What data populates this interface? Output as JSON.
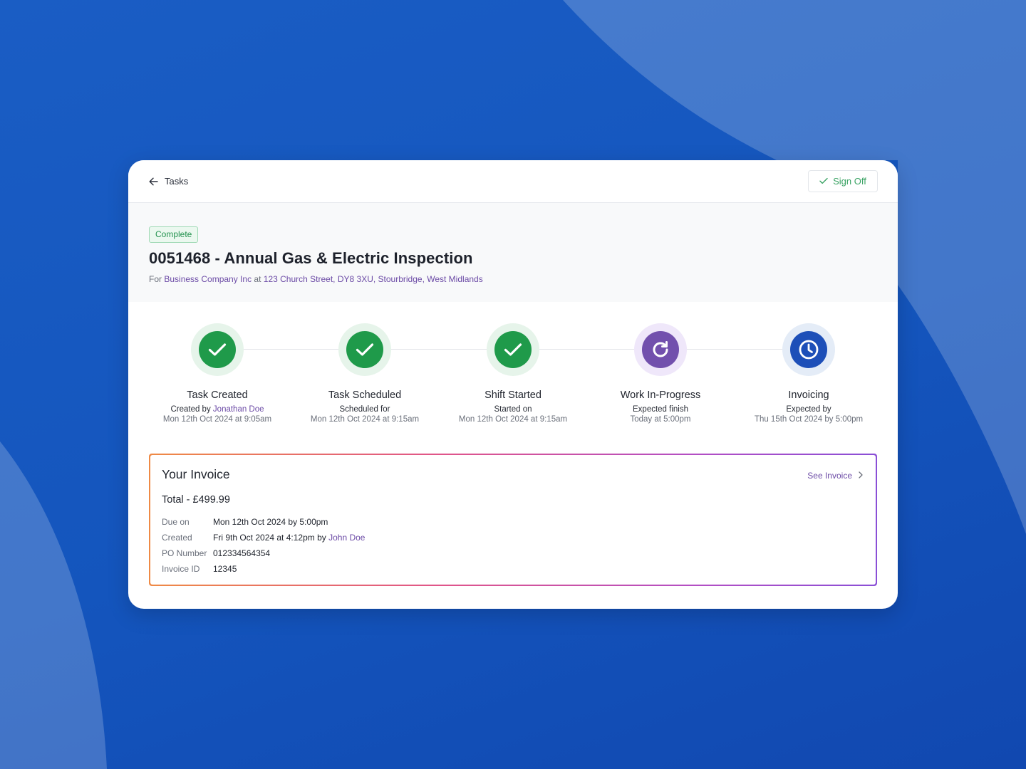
{
  "colors": {
    "background": "#1657bd",
    "success": "#1f9a4a",
    "success_ring": "#e6f4ea",
    "progress": "#7250ad",
    "progress_ring": "#efe7fa",
    "pending": "#1d4fb8",
    "pending_ring": "#e4ecf7",
    "link": "#6c4ba6"
  },
  "topbar": {
    "back_label": "Tasks",
    "signoff_label": "Sign Off"
  },
  "task": {
    "status": "Complete",
    "title": "0051468 - Annual Gas & Electric Inspection",
    "for_prefix": "For",
    "company": "Business Company Inc",
    "at": "at",
    "address": "123 Church Street, DY8 3XU, Stourbridge, West Midlands"
  },
  "steps": [
    {
      "title": "Task Created",
      "sub_prefix": "Created by",
      "sub_link": "Jonathan Doe",
      "date": "Mon 12th Oct 2024 at 9:05am",
      "icon": "check-icon",
      "state": "done"
    },
    {
      "title": "Task Scheduled",
      "sub_prefix": "Scheduled for",
      "sub_link": "",
      "date": "Mon 12th Oct 2024 at 9:15am",
      "icon": "check-icon",
      "state": "done"
    },
    {
      "title": "Shift Started",
      "sub_prefix": "Started on",
      "sub_link": "",
      "date": "Mon 12th Oct 2024 at 9:15am",
      "icon": "check-icon",
      "state": "done"
    },
    {
      "title": "Work In-Progress",
      "sub_prefix": "Expected finish",
      "sub_link": "",
      "date": "Today at 5:00pm",
      "icon": "refresh-icon",
      "state": "in-progress"
    },
    {
      "title": "Invoicing",
      "sub_prefix": "Expected by",
      "sub_link": "",
      "date": "Thu 15th Oct 2024 by 5:00pm",
      "icon": "clock-icon",
      "state": "pending"
    }
  ],
  "invoice": {
    "heading": "Your Invoice",
    "total": "Total - £499.99",
    "see_invoice": "See Invoice",
    "rows": [
      {
        "label": "Due on",
        "value": "Mon 12th Oct 2024 by 5:00pm",
        "link": ""
      },
      {
        "label": "Created",
        "value": "Fri 9th Oct 2024 at 4:12pm by",
        "link": "John Doe"
      },
      {
        "label": "PO Number",
        "value": "012334564354",
        "link": ""
      },
      {
        "label": "Invoice ID",
        "value": "12345",
        "link": ""
      }
    ]
  }
}
